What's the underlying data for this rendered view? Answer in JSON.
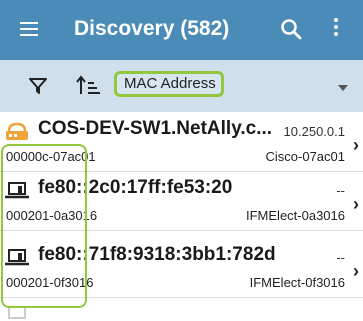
{
  "appbar": {
    "title": "Discovery (582)",
    "menu_icon": "hamburger-menu-icon",
    "search_icon": "search-icon",
    "more_icon": "more-vert-icon",
    "bg_color": "#4b8bb7"
  },
  "toolbar": {
    "filter_icon": "filter-icon",
    "sort_icon": "sort-icon",
    "sort_field": "MAC Address",
    "highlight_color": "#92c83e"
  },
  "devices": [
    {
      "icon": "switch-icon",
      "name": "COS-DEV-SW1.NetAlly.c...",
      "ip": "10.250.0.1",
      "mac": "00000c-07ac01",
      "label": "Cisco-07ac01"
    },
    {
      "icon": "laptop-icon",
      "name": "fe80::2c0:17ff:fe53:20",
      "ip": "--",
      "mac": "000201-0a3016",
      "label": "IFMElect-0a3016"
    },
    {
      "icon": "laptop-icon",
      "name": "fe80::71f8:9318:3bb1:782d",
      "ip": "--",
      "mac": "000201-0f3016",
      "label": "IFMElect-0f3016"
    }
  ],
  "partial_row": {
    "icon": "laptop-icon"
  }
}
